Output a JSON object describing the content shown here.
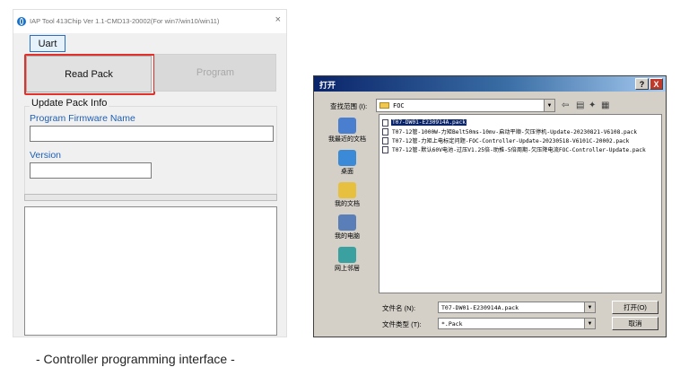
{
  "iap_window": {
    "title": "IAP Tool 413Chip Ver 1.1-CMD13-20002(For win7/win10/win11)",
    "close_glyph": "×",
    "tab_label": "Uart",
    "read_button": "Read Pack",
    "program_button": "Program",
    "group_title": "Update Pack Info",
    "firmware_label": "Program Firmware Name",
    "firmware_value": "",
    "version_label": "Version",
    "version_value": ""
  },
  "caption": "- Controller programming interface -",
  "open_dialog": {
    "title": "打开",
    "help_glyph": "?",
    "close_glyph": "X",
    "look_in_label": "查找范围 (I):",
    "look_in_value": "FOC",
    "places": [
      {
        "label": "我最近的文档",
        "icon": "recent-documents-icon",
        "color": "#4a7fd0"
      },
      {
        "label": "桌面",
        "icon": "desktop-icon",
        "color": "#3a8ad8"
      },
      {
        "label": "我的文档",
        "icon": "my-documents-icon",
        "color": "#e8c040"
      },
      {
        "label": "我的电脑",
        "icon": "my-computer-icon",
        "color": "#5a7fb8"
      },
      {
        "label": "网上邻居",
        "icon": "network-icon",
        "color": "#3aa0a0"
      }
    ],
    "files": [
      "T07-DW01-E230914A.pack",
      "T07-12管-1000W-力矩Belt50ms-10mv-启动平顺-欠压停机-Update-20230821-V6108.pack",
      "T07-12管-力矩上电标定问题-FOC-Controller-Update-20230518-V6101C-20002.pack",
      "T07-12管-默认60V电池-过压V1.25倍-助推-5倍周期-欠压降电流FOC-Controller-Update.pack"
    ],
    "filename_label": "文件名 (N):",
    "filename_value": "T07-DW01-E230914A.pack",
    "filetype_label": "文件类型 (T):",
    "filetype_value": "*.Pack",
    "open_button": "打开(O)",
    "cancel_button": "取消",
    "accent_color": "#0a246a",
    "highlight_color": "#e3302a"
  }
}
